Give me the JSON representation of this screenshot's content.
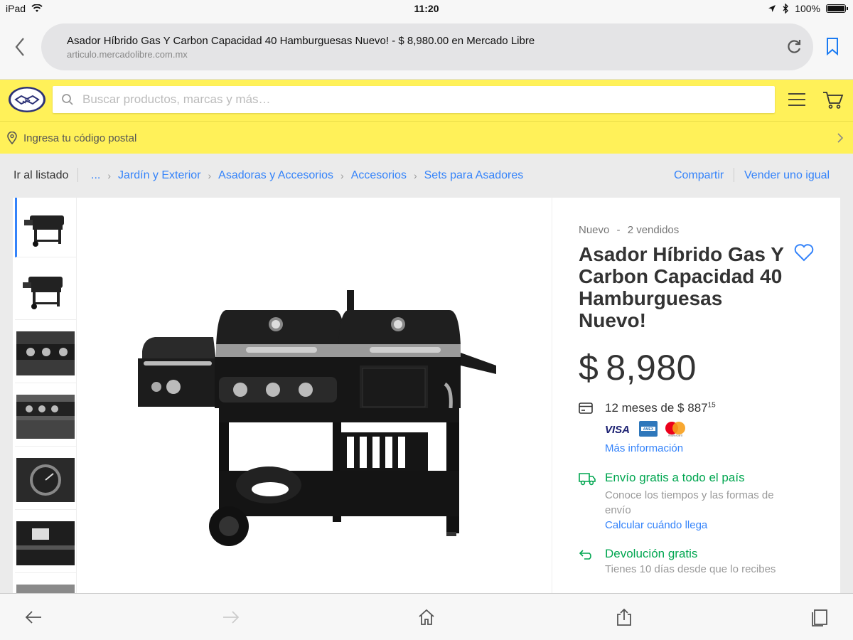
{
  "status_bar": {
    "device": "iPad",
    "time": "11:20",
    "battery": "100%"
  },
  "browser": {
    "page_title": "Asador Híbrido Gas Y Carbon Capacidad 40 Hamburguesas Nuevo! - $ 8,980.00 en Mercado Libre",
    "host": "articulo.mercadolibre.com.mx",
    "icons": [
      "back-icon",
      "reload-icon",
      "bookmark-icon"
    ]
  },
  "header": {
    "search_placeholder": "Buscar productos, marcas y más…",
    "icons": [
      "mercadolibre-logo",
      "search-icon",
      "menu-icon",
      "cart-icon"
    ]
  },
  "postal": {
    "label": "Ingresa tu código postal"
  },
  "breadcrumb": {
    "back_label": "Ir al listado",
    "items": [
      "...",
      "Jardín y Exterior",
      "Asadoras y Accesorios",
      "Accesorios",
      "Sets para Asadores"
    ],
    "share": "Compartir",
    "sell": "Vender uno igual"
  },
  "product": {
    "condition": "Nuevo",
    "condition_sep": "-",
    "sold": "2 vendidos",
    "title": "Asador Híbrido Gas Y Carbon Capacidad 40 Hamburguesas Nuevo!",
    "currency": "$",
    "price": "8,980",
    "installments_text": "12 meses de $ 887",
    "installments_cents": "15",
    "card_brands": [
      "VISA",
      "AMEX",
      "mastercard"
    ],
    "more_info": "Más información",
    "shipping_title": "Envío gratis a todo el país",
    "shipping_sub": "Conoce los tiempos y las formas de envío",
    "shipping_link": "Calcular cuándo llega",
    "return_title": "Devolución gratis",
    "return_sub": "Tienes 10 días desde que lo recibes",
    "thumbnail_count": 7
  },
  "colors": {
    "brand_yellow": "#fff159",
    "link_blue": "#3483fa",
    "green": "#00a650"
  },
  "toolbar": {
    "icons": [
      "back-arrow-icon",
      "forward-arrow-icon",
      "home-icon",
      "share-icon",
      "tabs-icon"
    ]
  }
}
